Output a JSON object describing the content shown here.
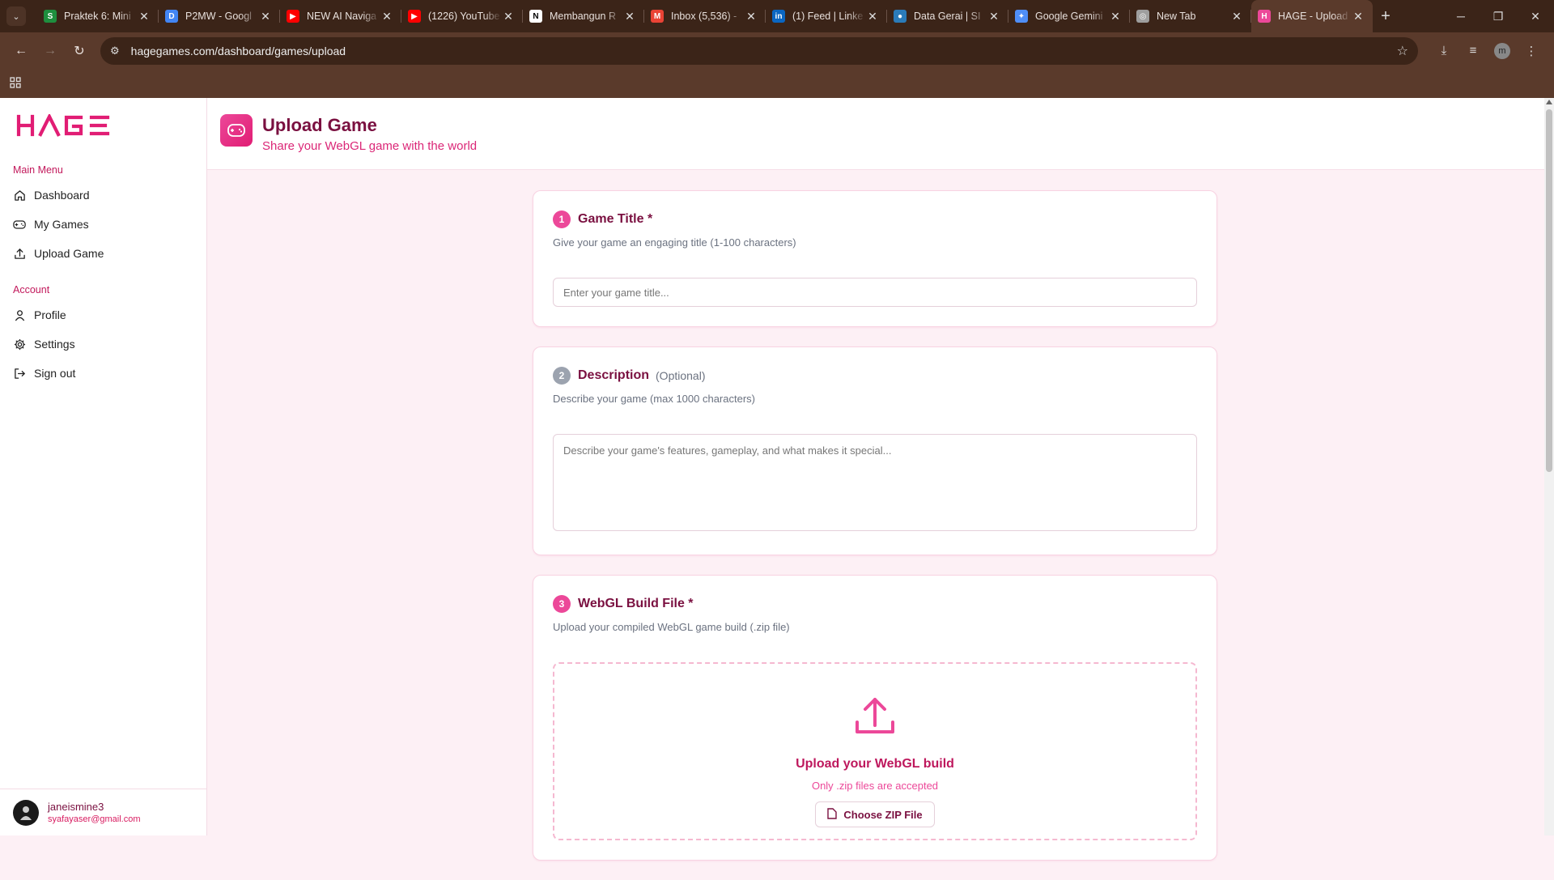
{
  "browser": {
    "tabs": [
      {
        "title": "Praktek 6: Mini",
        "color": "#1e8e3e",
        "glyph": "S"
      },
      {
        "title": "P2MW - Googl",
        "color": "#4285f4",
        "glyph": "D"
      },
      {
        "title": "NEW AI Naviga",
        "color": "#ff0000",
        "glyph": "▶"
      },
      {
        "title": "(1226) YouTube",
        "color": "#ff0000",
        "glyph": "▶"
      },
      {
        "title": "Membangun R",
        "color": "#ffffff",
        "glyph": "N"
      },
      {
        "title": "Inbox (5,536) -",
        "color": "#ea4335",
        "glyph": "M"
      },
      {
        "title": "(1) Feed | Linke",
        "color": "#0a66c2",
        "glyph": "in"
      },
      {
        "title": "Data Gerai | SI",
        "color": "#2b7bb9",
        "glyph": "●"
      },
      {
        "title": "Google Gemini",
        "color": "#4f8ef7",
        "glyph": "✦"
      },
      {
        "title": "New Tab",
        "color": "#9e9e9e",
        "glyph": "◎"
      },
      {
        "title": "HAGE - Upload",
        "color": "#ec4899",
        "glyph": "H",
        "active": true
      }
    ],
    "url": "hagegames.com/dashboard/games/upload",
    "profile_initial": "m"
  },
  "sidebar": {
    "main_menu_label": "Main Menu",
    "main_items": [
      {
        "label": "Dashboard",
        "icon": "home-icon"
      },
      {
        "label": "My Games",
        "icon": "gamepad-icon"
      },
      {
        "label": "Upload Game",
        "icon": "upload-icon"
      }
    ],
    "account_label": "Account",
    "account_items": [
      {
        "label": "Profile",
        "icon": "user-icon"
      },
      {
        "label": "Settings",
        "icon": "gear-icon"
      },
      {
        "label": "Sign out",
        "icon": "sign-out-icon"
      }
    ],
    "user": {
      "name": "janeismine3",
      "email": "syafayaser@gmail.com"
    }
  },
  "header": {
    "title": "Upload Game",
    "subtitle": "Share your WebGL game with the world"
  },
  "form": {
    "title_section": {
      "number": "1",
      "title": "Game Title *",
      "description": "Give your game an engaging title (1-100 characters)",
      "placeholder": "Enter your game title...",
      "value": ""
    },
    "description_section": {
      "number": "2",
      "title": "Description",
      "optional": "(Optional)",
      "description": "Describe your game (max 1000 characters)",
      "placeholder": "Describe your game's features, gameplay, and what makes it special...",
      "value": ""
    },
    "file_section": {
      "number": "3",
      "title": "WebGL Build File *",
      "description": "Upload your compiled WebGL game build (.zip file)",
      "drop_title": "Upload your WebGL build",
      "drop_sub": "Only .zip files are accepted",
      "button": "Choose ZIP File"
    }
  },
  "colors": {
    "brand": "#e11d74",
    "chrome": "#3b2418"
  }
}
